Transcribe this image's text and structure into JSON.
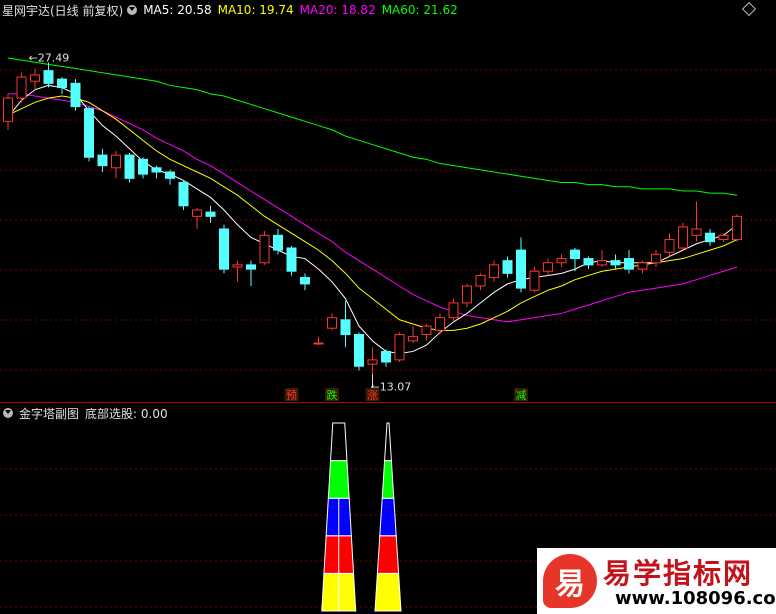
{
  "header": {
    "title": "星网宇达(日线 前复权)",
    "ma_labels": [
      {
        "text": "MA5: 20.58",
        "color": "#ffffff"
      },
      {
        "text": "MA10: 19.74",
        "color": "#ffff00"
      },
      {
        "text": "MA20: 18.82",
        "color": "#ff00ff"
      },
      {
        "text": "MA60: 21.62",
        "color": "#00ff00"
      }
    ]
  },
  "sub_header": {
    "title": "金字塔副图",
    "indicator": "底部选股: 0.00"
  },
  "colors": {
    "up": "#ff3232",
    "down": "#54ffff",
    "ma5": "#ffffff",
    "ma10": "#ffff00",
    "ma20": "#ff00ff",
    "ma60": "#00ff00",
    "grid": "#7a0000",
    "separator": "#b00000"
  },
  "chart_data": [
    {
      "type": "candlestick",
      "title": "星网宇达(日线 前复权)",
      "y_range": [
        11.5,
        29.5
      ],
      "high_annotation": "27.49",
      "low_annotation": "13.07",
      "candles": [
        [
          24.7,
          25.8,
          24.3,
          26.0
        ],
        [
          25.8,
          26.8,
          25.6,
          27.0
        ],
        [
          26.6,
          26.9,
          26.2,
          27.2
        ],
        [
          27.1,
          26.5,
          26.3,
          27.49
        ],
        [
          26.7,
          26.3,
          26.0,
          26.8
        ],
        [
          26.5,
          25.4,
          25.2,
          26.7
        ],
        [
          25.3,
          23.0,
          22.8,
          25.4
        ],
        [
          23.1,
          22.6,
          22.3,
          23.4
        ],
        [
          22.5,
          23.1,
          22.0,
          23.3
        ],
        [
          23.1,
          22.0,
          21.8,
          23.2
        ],
        [
          22.9,
          22.2,
          22.0,
          23.0
        ],
        [
          22.5,
          22.3,
          22.0,
          22.6
        ],
        [
          22.3,
          22.0,
          21.7,
          22.4
        ],
        [
          21.8,
          20.7,
          20.5,
          21.9
        ],
        [
          20.2,
          20.5,
          19.6,
          20.6
        ],
        [
          20.4,
          20.2,
          19.9,
          20.7
        ],
        [
          19.6,
          17.7,
          17.5,
          19.8
        ],
        [
          17.8,
          17.9,
          17.1,
          18.1
        ],
        [
          17.9,
          17.7,
          16.9,
          18.1
        ],
        [
          18.0,
          19.3,
          17.9,
          19.5
        ],
        [
          19.3,
          18.6,
          18.4,
          19.6
        ],
        [
          18.7,
          17.6,
          17.4,
          18.8
        ],
        [
          17.3,
          17.0,
          16.7,
          17.5
        ],
        [
          14.2,
          14.2,
          14.1,
          14.5
        ],
        [
          14.9,
          15.4,
          14.8,
          15.6
        ],
        [
          15.3,
          14.6,
          14.0,
          16.2
        ],
        [
          14.6,
          13.1,
          12.9,
          14.7
        ],
        [
          13.2,
          13.4,
          12.7,
          14.0
        ],
        [
          13.8,
          13.3,
          13.07,
          13.9
        ],
        [
          13.4,
          14.6,
          13.3,
          14.7
        ],
        [
          14.3,
          14.5,
          14.2,
          15.0
        ],
        [
          14.6,
          15.0,
          14.3,
          15.1
        ],
        [
          14.8,
          15.4,
          14.6,
          15.6
        ],
        [
          15.4,
          16.1,
          15.2,
          16.3
        ],
        [
          16.1,
          16.9,
          15.9,
          17.0
        ],
        [
          16.9,
          17.4,
          16.7,
          17.5
        ],
        [
          17.3,
          17.9,
          17.1,
          18.1
        ],
        [
          18.1,
          17.5,
          17.3,
          18.3
        ],
        [
          18.6,
          16.8,
          16.6,
          19.2
        ],
        [
          16.7,
          17.6,
          16.6,
          17.8
        ],
        [
          17.6,
          18.0,
          17.4,
          18.2
        ],
        [
          18.0,
          18.2,
          17.8,
          18.4
        ],
        [
          18.6,
          18.2,
          17.6,
          18.7
        ],
        [
          18.2,
          17.9,
          17.7,
          18.3
        ],
        [
          17.9,
          18.1,
          17.8,
          18.6
        ],
        [
          18.1,
          17.9,
          17.7,
          18.4
        ],
        [
          18.2,
          17.7,
          17.5,
          18.6
        ],
        [
          17.7,
          18.0,
          17.5,
          18.1
        ],
        [
          18.0,
          18.4,
          17.8,
          18.6
        ],
        [
          18.5,
          19.1,
          18.3,
          19.4
        ],
        [
          18.7,
          19.7,
          18.6,
          19.9
        ],
        [
          19.3,
          19.6,
          19.0,
          20.9
        ],
        [
          19.4,
          19.0,
          18.8,
          19.6
        ],
        [
          19.1,
          19.3,
          19.0,
          19.4
        ],
        [
          19.1,
          20.2,
          19.0,
          20.3
        ]
      ],
      "ma_lines": {
        "ma5": [
          24.9,
          25.7,
          26.2,
          26.4,
          26.3,
          26.0,
          25.2,
          24.5,
          24.0,
          23.4,
          22.8,
          22.4,
          22.2,
          21.9,
          21.5,
          21.1,
          20.5,
          19.8,
          19.2,
          18.9,
          18.6,
          18.3,
          18.2,
          17.7,
          17.1,
          16.3,
          15.0,
          14.3,
          13.8,
          13.7,
          13.8,
          14.1,
          14.7,
          15.2,
          15.6,
          16.1,
          16.6,
          17.0,
          17.2,
          17.3,
          17.4,
          17.5,
          17.7,
          18.0,
          18.1,
          18.0,
          18.0,
          18.0,
          18.0,
          18.3,
          18.6,
          18.9,
          19.1,
          19.3,
          19.8
        ],
        "ma10": [
          25.0,
          25.3,
          25.6,
          25.8,
          25.9,
          25.8,
          25.6,
          25.2,
          24.8,
          24.3,
          23.8,
          23.3,
          22.9,
          22.6,
          22.3,
          22.0,
          21.6,
          21.2,
          20.7,
          20.2,
          19.8,
          19.4,
          19.0,
          18.6,
          18.1,
          17.5,
          16.8,
          16.3,
          15.8,
          15.3,
          15.1,
          14.9,
          14.8,
          14.8,
          14.9,
          15.1,
          15.4,
          15.7,
          16.1,
          16.4,
          16.7,
          16.9,
          17.2,
          17.4,
          17.6,
          17.7,
          17.8,
          17.9,
          18.0,
          18.1,
          18.2,
          18.4,
          18.6,
          18.8,
          19.1
        ],
        "ma20": [
          26.0,
          26.0,
          25.9,
          25.8,
          25.7,
          25.6,
          25.4,
          25.2,
          24.9,
          24.6,
          24.3,
          23.9,
          23.6,
          23.3,
          22.9,
          22.6,
          22.2,
          21.8,
          21.4,
          21.0,
          20.6,
          20.2,
          19.8,
          19.4,
          19.0,
          18.5,
          18.1,
          17.7,
          17.3,
          16.9,
          16.5,
          16.2,
          15.9,
          15.7,
          15.5,
          15.4,
          15.3,
          15.2,
          15.3,
          15.4,
          15.5,
          15.6,
          15.8,
          16.0,
          16.2,
          16.4,
          16.6,
          16.7,
          16.8,
          16.9,
          17.0,
          17.2,
          17.4,
          17.6,
          17.8
        ],
        "ma60": [
          27.7,
          27.6,
          27.5,
          27.4,
          27.3,
          27.2,
          27.1,
          27.0,
          26.9,
          26.8,
          26.7,
          26.6,
          26.4,
          26.3,
          26.2,
          26.0,
          25.9,
          25.7,
          25.5,
          25.3,
          25.1,
          24.9,
          24.7,
          24.5,
          24.3,
          24.0,
          23.8,
          23.6,
          23.4,
          23.2,
          23.0,
          22.9,
          22.7,
          22.6,
          22.5,
          22.4,
          22.3,
          22.2,
          22.1,
          22.0,
          21.9,
          21.8,
          21.8,
          21.7,
          21.7,
          21.6,
          21.6,
          21.5,
          21.5,
          21.5,
          21.4,
          21.4,
          21.3,
          21.3,
          21.2
        ]
      },
      "signals": [
        {
          "index": 21,
          "label": "预",
          "color": "#ff3232"
        },
        {
          "index": 24,
          "label": "跌",
          "color": "#00ff00"
        },
        {
          "index": 27,
          "label": "涨",
          "color": "#ff3232"
        },
        {
          "index": 38,
          "label": "减",
          "color": "#00ff00"
        }
      ]
    },
    {
      "type": "bar",
      "title": "金字塔副图",
      "ylabel": "底部选股",
      "stack_bands": [
        "#ffff00",
        "#ff0000",
        "#0000ff",
        "#00ff00",
        "#ffff00"
      ],
      "pyramids": [
        {
          "start_index": 24,
          "end_index": 25,
          "twin_peaks": true
        },
        {
          "start_index": 28,
          "end_index": 28,
          "twin_peaks": false
        }
      ]
    }
  ],
  "watermark": {
    "logo_char": "易",
    "title": "易学指标网",
    "url": "www.108096.com"
  }
}
